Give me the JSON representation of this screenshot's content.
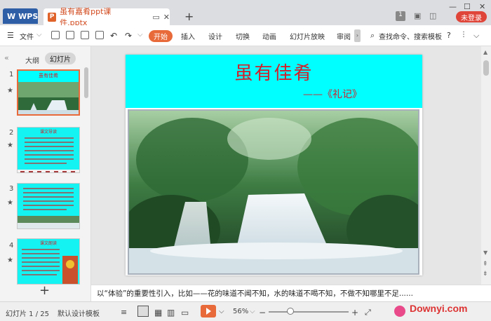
{
  "titlebar": {
    "app_label": "WPS",
    "file_name": "虽有嘉肴ppt课件.pptx",
    "login_label": "未登录"
  },
  "menu": {
    "file": "文件",
    "tabs": [
      "开始",
      "插入",
      "设计",
      "切换",
      "动画",
      "幻灯片放映",
      "审阅"
    ],
    "search": "查找命令、搜索模板"
  },
  "panel": {
    "outline_tab": "大纲",
    "slides_tab": "幻灯片",
    "thumbs": [
      {
        "num": "1",
        "title": "虽有佳肴"
      },
      {
        "num": "2",
        "title": "课文导读"
      },
      {
        "num": "3",
        "title": ""
      },
      {
        "num": "4",
        "title": "课文朗读"
      }
    ]
  },
  "slide": {
    "title": "虽有佳肴",
    "subtitle": "——《礼记》"
  },
  "notes": {
    "text": "以“体验”的重要性引入，比如——花的味道不闻不知，水的味道不喝不知，不做不知哪里不足......"
  },
  "status": {
    "slide_counter": "幻灯片 1 / 25",
    "template": "默认设计模板",
    "zoom": "56%",
    "watermark": "Downyi.com"
  },
  "colors": {
    "accent": "#e86a3a",
    "slide_header": "#00ffff",
    "title_red": "#d1202a",
    "wps_blue": "#2e5ea5"
  }
}
